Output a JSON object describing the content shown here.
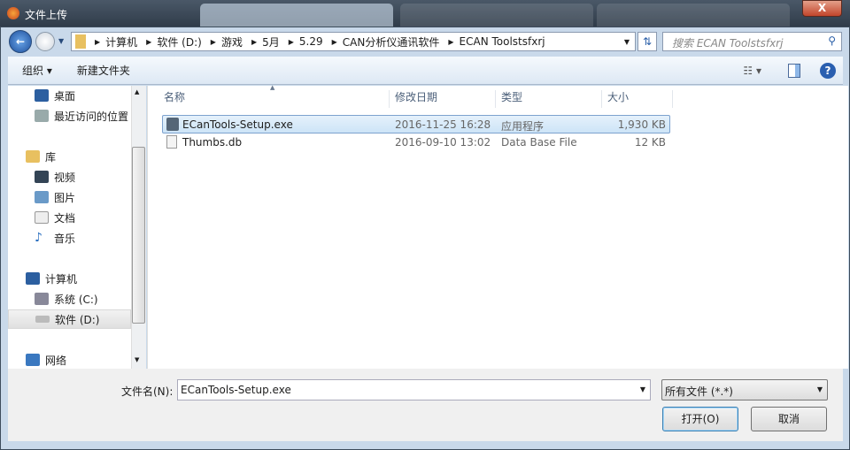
{
  "window": {
    "title": "文件上传",
    "close": "X"
  },
  "address": {
    "crumbs": [
      "计算机",
      "软件 (D:)",
      "游戏",
      "5月",
      "5.29",
      "CAN分析仪通讯软件",
      "ECAN Toolstsfxrj"
    ],
    "search_placeholder": "搜索 ECAN Toolstsfxrj"
  },
  "toolbar": {
    "organize": "组织 ▾",
    "new_folder": "新建文件夹"
  },
  "sidebar": {
    "items": [
      {
        "label": "桌面"
      },
      {
        "label": "最近访问的位置"
      },
      {
        "label": "库"
      },
      {
        "label": "视频"
      },
      {
        "label": "图片"
      },
      {
        "label": "文档"
      },
      {
        "label": "音乐"
      },
      {
        "label": "计算机"
      },
      {
        "label": "系统 (C:)"
      },
      {
        "label": "软件 (D:)"
      },
      {
        "label": "网络"
      }
    ]
  },
  "columns": {
    "name": "名称",
    "date": "修改日期",
    "type": "类型",
    "size": "大小"
  },
  "files": [
    {
      "name": "ECanTools-Setup.exe",
      "date": "2016-11-25 16:28",
      "type": "应用程序",
      "size": "1,930 KB"
    },
    {
      "name": "Thumbs.db",
      "date": "2016-09-10 13:02",
      "type": "Data Base File",
      "size": "12 KB"
    }
  ],
  "footer": {
    "filename_label": "文件名(N):",
    "filename": "ECanTools-Setup.exe",
    "filetype": "所有文件 (*.*)",
    "open": "打开(O)",
    "cancel": "取消"
  }
}
